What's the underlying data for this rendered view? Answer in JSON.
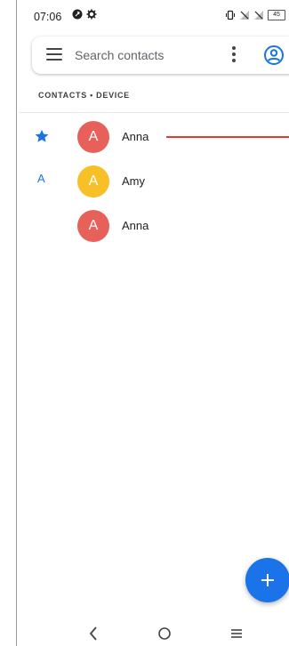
{
  "status_bar": {
    "time": "07:06",
    "battery": "45"
  },
  "search": {
    "placeholder": "Search contacts"
  },
  "list": {
    "section_header": "CONTACTS • DEVICE",
    "rows": [
      {
        "indicator": "star-icon",
        "letter": "",
        "avatar_letter": "A",
        "avatar_color": "#e8605a",
        "name": "Anna"
      },
      {
        "indicator": "",
        "letter": "A",
        "avatar_letter": "A",
        "avatar_color": "#f6c026",
        "name": "Amy"
      },
      {
        "indicator": "",
        "letter": "",
        "avatar_letter": "A",
        "avatar_color": "#e8605a",
        "name": "Anna"
      }
    ]
  },
  "colors": {
    "accent": "#1a73e8",
    "swipe_line": "#e53935"
  },
  "fab": {
    "icon": "plus-icon"
  },
  "nav": {
    "back": "chevron-left-icon",
    "home": "circle-home-icon",
    "recents": "menu-lines-icon"
  }
}
